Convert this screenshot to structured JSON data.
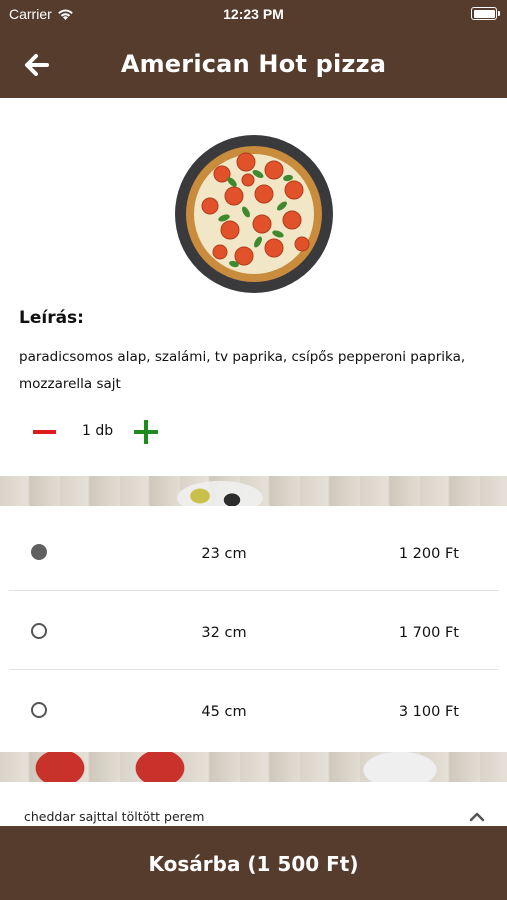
{
  "status_bar": {
    "carrier": "Carrier",
    "time": "12:23 PM"
  },
  "nav": {
    "title": "American Hot pizza",
    "back_icon": "arrow-left-icon"
  },
  "product": {
    "image_icon": "pizza-image",
    "description_label": "Leírás:",
    "description": "paradicsomos alap, szalámi, tv paprika, csípős pepperoni paprika, mozzarella  sajt"
  },
  "quantity": {
    "value": "1 db",
    "minus_icon": "minus-icon",
    "plus_icon": "plus-icon",
    "colors": {
      "minus": "#e01b1b",
      "plus": "#1c8c1c"
    }
  },
  "sizes": [
    {
      "size": "23 cm",
      "price": "1 200 Ft",
      "selected": true
    },
    {
      "size": "32 cm",
      "price": "1 700 Ft",
      "selected": false
    },
    {
      "size": "45 cm",
      "price": "3 100 Ft",
      "selected": false
    }
  ],
  "extra": {
    "label": "cheddar sajttal töltött perem",
    "icon": "chevron-up-icon"
  },
  "cart": {
    "label": "Kosárba (1 500 Ft)"
  },
  "theme": {
    "brand_brown": "#553c2d"
  }
}
